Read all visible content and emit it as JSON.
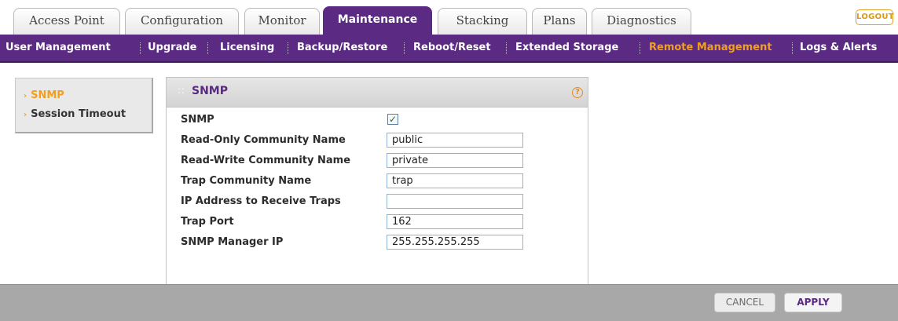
{
  "tabs": [
    {
      "label": "Access Point"
    },
    {
      "label": "Configuration"
    },
    {
      "label": "Monitor"
    },
    {
      "label": "Maintenance"
    },
    {
      "label": "Stacking"
    },
    {
      "label": "Plans"
    },
    {
      "label": "Diagnostics"
    }
  ],
  "active_tab": "Maintenance",
  "logout_label": "LOGOUT",
  "subnav": [
    {
      "label": "User Management"
    },
    {
      "label": "Upgrade"
    },
    {
      "label": "Licensing"
    },
    {
      "label": "Backup/Restore"
    },
    {
      "label": "Reboot/Reset"
    },
    {
      "label": "Extended Storage"
    },
    {
      "label": "Remote Management"
    },
    {
      "label": "Logs & Alerts"
    }
  ],
  "active_subnav": "Remote Management",
  "sidenav": [
    {
      "label": "SNMP"
    },
    {
      "label": "Session Timeout"
    }
  ],
  "active_sidenav": "SNMP",
  "panel": {
    "title": "SNMP",
    "help_icon": "?",
    "snmp_label": "SNMP",
    "snmp_checked": true,
    "fields": [
      {
        "label": "Read-Only Community Name",
        "value": "public"
      },
      {
        "label": "Read-Write Community Name",
        "value": "private"
      },
      {
        "label": "Trap Community Name",
        "value": "trap"
      },
      {
        "label": "IP Address to Receive Traps",
        "value": ""
      },
      {
        "label": "Trap Port",
        "value": "162"
      },
      {
        "label": "SNMP Manager IP",
        "value": "255.255.255.255"
      }
    ]
  },
  "buttons": {
    "cancel": "CANCEL",
    "apply": "APPLY"
  },
  "colors": {
    "brand_purple": "#5b2a82",
    "active_orange": "#f0a01e",
    "bottom_bar": "#a8a8a8"
  }
}
